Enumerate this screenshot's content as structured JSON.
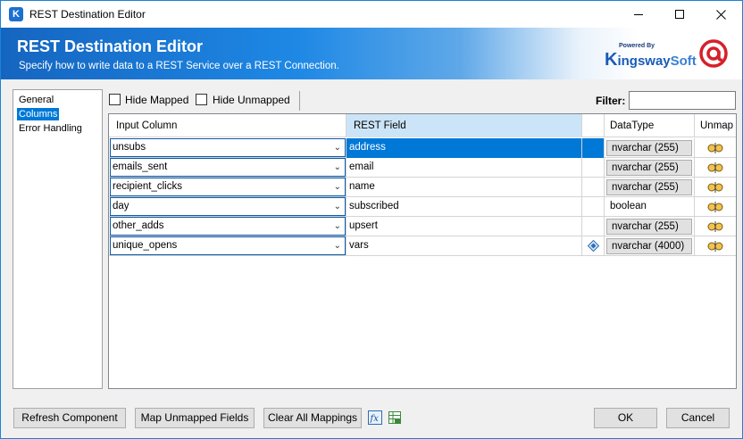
{
  "window": {
    "title": "REST Destination Editor",
    "app_icon": "K"
  },
  "banner": {
    "title": "REST Destination Editor",
    "subtitle": "Specify how to write data to a REST Service over a REST Connection.",
    "brand_powered": "Powered By",
    "brand_k": "K",
    "brand_ingsway": "ingsway",
    "brand_soft": "Soft"
  },
  "nav": {
    "items": [
      {
        "label": "General",
        "selected": false
      },
      {
        "label": "Columns",
        "selected": true
      },
      {
        "label": "Error Handling",
        "selected": false
      }
    ]
  },
  "toolbar": {
    "hide_mapped": "Hide Mapped",
    "hide_unmapped": "Hide Unmapped",
    "filter_label": "Filter:",
    "filter_value": ""
  },
  "grid": {
    "headers": {
      "input_column": "Input Column",
      "rest_field": "REST Field",
      "data_type": "DataType",
      "unmap": "Unmap"
    },
    "rows": [
      {
        "input": "unsubs",
        "field": "address",
        "type": "nvarchar (255)",
        "type_boxed": true,
        "selected": true,
        "diamond": false
      },
      {
        "input": "emails_sent",
        "field": "email",
        "type": "nvarchar (255)",
        "type_boxed": true,
        "selected": false,
        "diamond": false
      },
      {
        "input": "recipient_clicks",
        "field": "name",
        "type": "nvarchar (255)",
        "type_boxed": true,
        "selected": false,
        "diamond": false
      },
      {
        "input": "day",
        "field": "subscribed",
        "type": "boolean",
        "type_boxed": false,
        "selected": false,
        "diamond": false
      },
      {
        "input": "other_adds",
        "field": "upsert",
        "type": "nvarchar (255)",
        "type_boxed": true,
        "selected": false,
        "diamond": false
      },
      {
        "input": "unique_opens",
        "field": "vars",
        "type": "nvarchar (4000)",
        "type_boxed": true,
        "selected": false,
        "diamond": true
      }
    ]
  },
  "buttons": {
    "refresh": "Refresh Component",
    "map_unmapped": "Map Unmapped Fields",
    "clear_all": "Clear All Mappings",
    "ok": "OK",
    "cancel": "Cancel"
  },
  "colors": {
    "accent": "#0078d7",
    "banner_start": "#1565c0"
  }
}
